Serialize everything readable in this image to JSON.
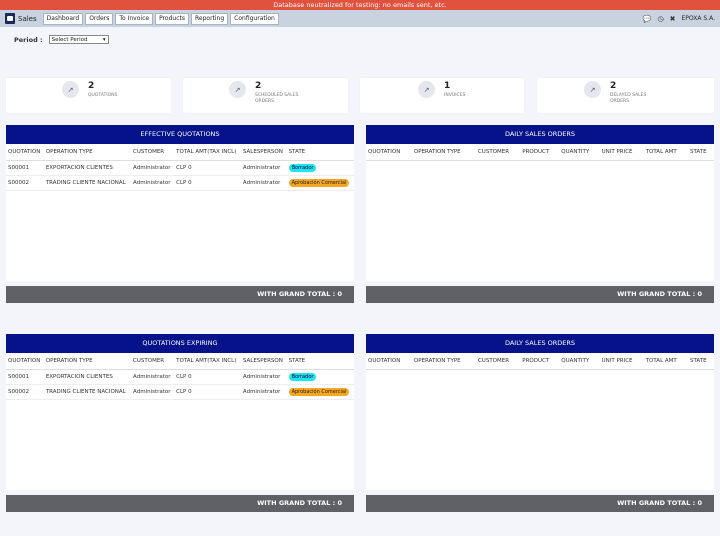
{
  "banner": "Database neutralized for testing: no emails sent, etc.",
  "nav": {
    "brand": "Sales",
    "tabs": [
      "Dashboard",
      "Orders",
      "To Invoice",
      "Products",
      "Reporting",
      "Configuration"
    ],
    "company": "EPOXA S.A."
  },
  "period": {
    "label": "Period :",
    "value": "Select Period"
  },
  "stats": [
    {
      "value": "2",
      "label": "QUOTATIONS"
    },
    {
      "value": "2",
      "label": "SCHEDULED SALES ORDERS"
    },
    {
      "value": "1",
      "label": "INVOICES"
    },
    {
      "value": "2",
      "label": "DELAYED SALES ORDERS"
    }
  ],
  "quotation_columns": [
    "QUOTATION",
    "OPERATION TYPE",
    "CUSTOMER",
    "TOTAL AMT(TAX INCL)",
    "SALESPERSON",
    "STATE"
  ],
  "order_columns": [
    "QUOTATION",
    "OPERATION TYPE",
    "CUSTOMER",
    "PRODUCT",
    "QUANTITY",
    "UNIT PRICE",
    "TOTAL AMT",
    "STATE"
  ],
  "effective": {
    "title": "EFFECTIVE QUOTATIONS",
    "rows": [
      [
        "S00001",
        "EXPORTACION CLIENTES",
        "Administrator",
        "CLP 0",
        "Administrator",
        "Borrador"
      ],
      [
        "S00002",
        "TRADING CLIENTE NACIONAL",
        "Administrator",
        "CLP 0",
        "Administrator",
        "Aprobación Comercial"
      ]
    ],
    "footer": "WITH GRAND TOTAL : 0"
  },
  "daily1": {
    "title": "DAILY SALES ORDERS",
    "footer": "WITH GRAND TOTAL : 0"
  },
  "expiring": {
    "title": "QUOTATIONS EXPIRING",
    "rows": [
      [
        "S00001",
        "EXPORTACION CLIENTES",
        "Administrator",
        "CLP 0",
        "Administrator",
        "Borrador"
      ],
      [
        "S00002",
        "TRADING CLIENTE NACIONAL",
        "Administrator",
        "CLP 0",
        "Administrator",
        "Aprobación Comercial"
      ]
    ],
    "footer": "WITH GRAND TOTAL : 0"
  },
  "daily2": {
    "title": "DAILY SALES ORDERS",
    "footer": "WITH GRAND TOTAL : 0"
  },
  "colors": {
    "header": "#06128a",
    "footer": "#5e6065",
    "badge_draft": "#21e2f0",
    "badge_approval": "#f5a623"
  }
}
